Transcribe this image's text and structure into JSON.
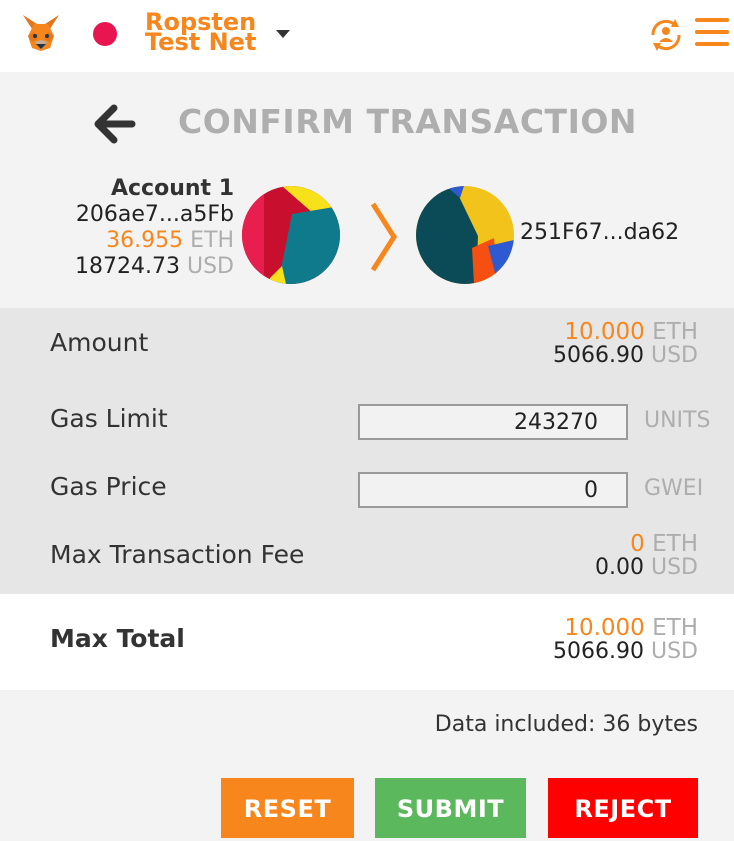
{
  "network": {
    "name_line1": "Ropsten",
    "name_line2": "Test Net",
    "dot_color": "#e91550"
  },
  "header": {
    "title": "CONFIRM TRANSACTION"
  },
  "from": {
    "account_name": "Account 1",
    "address": "206ae7...a5Fb",
    "balance_eth": "36.955",
    "balance_eth_unit": "ETH",
    "balance_usd": "18724.73",
    "balance_usd_unit": "USD"
  },
  "to": {
    "address": "251F67...da62"
  },
  "details": {
    "amount": {
      "label": "Amount",
      "eth": "10.000",
      "eth_unit": "ETH",
      "usd": "5066.90",
      "usd_unit": "USD"
    },
    "gas_limit": {
      "label": "Gas Limit",
      "value": "243270",
      "unit": "UNITS"
    },
    "gas_price": {
      "label": "Gas Price",
      "value": "0",
      "unit": "GWEI"
    },
    "max_fee": {
      "label": "Max Transaction Fee",
      "eth": "0",
      "eth_unit": "ETH",
      "usd": "0.00",
      "usd_unit": "USD"
    }
  },
  "total": {
    "label": "Max Total",
    "eth": "10.000",
    "eth_unit": "ETH",
    "usd": "5066.90",
    "usd_unit": "USD"
  },
  "footer": {
    "data_included": "Data included: 36 bytes",
    "reset_label": "RESET",
    "submit_label": "SUBMIT",
    "reject_label": "REJECT"
  },
  "icons": {
    "logo": "metamask-fox-icon",
    "account_switch": "account-switch-icon",
    "menu": "hamburger-menu-icon",
    "back": "back-arrow-icon",
    "chevron": "chevron-right-icon"
  },
  "colors": {
    "accent": "#f7861c",
    "submit": "#5cb85c",
    "reject": "#ff0000",
    "muted": "#aeaeae"
  }
}
